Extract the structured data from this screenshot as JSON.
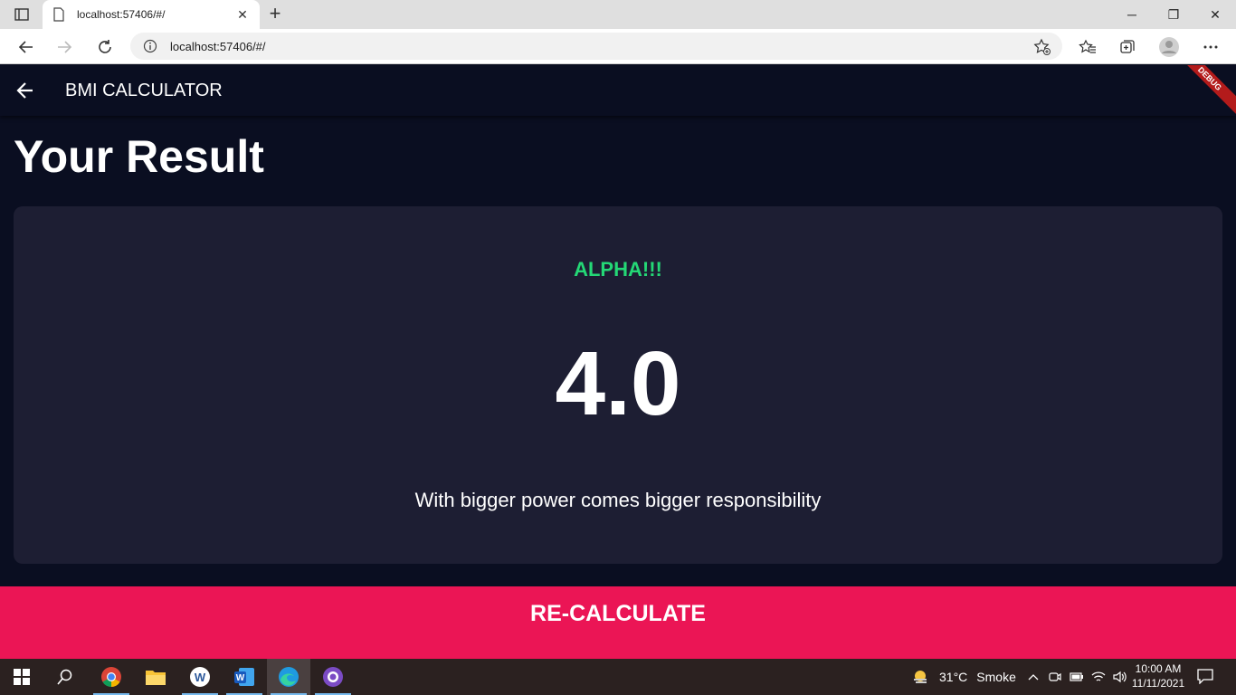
{
  "browser": {
    "tab_title": "localhost:57406/#/",
    "url": "localhost:57406/#/",
    "icons": [
      "tab-actions-icon",
      "page-icon",
      "close-icon",
      "new-tab-icon",
      "back-icon",
      "forward-icon",
      "reload-icon",
      "info-icon",
      "add-favorite-icon",
      "favorites-icon",
      "collections-icon",
      "profile-icon",
      "more-icon"
    ]
  },
  "app": {
    "appbar_title": "BMI CALCULATOR",
    "debug_banner": "DEBUG",
    "page_title": "Your Result",
    "result_status": "ALPHA!!!",
    "bmi_value": "4.0",
    "interpretation": "With bigger power comes bigger responsibility",
    "recalculate_label": "RE-CALCULATE",
    "colors": {
      "background": "#0a0e21",
      "card": "#1d1e33",
      "status_green": "#24d876",
      "accent_pink": "#eb1555"
    }
  },
  "taskbar": {
    "weather_temp": "31°C",
    "weather_desc": "Smoke",
    "time": "10:00 AM",
    "date": "11/11/2021",
    "apps": [
      "start-icon",
      "search-icon",
      "chrome-icon",
      "file-explorer-icon",
      "word-icon-a",
      "word-icon-b",
      "edge-icon",
      "github-icon"
    ]
  }
}
